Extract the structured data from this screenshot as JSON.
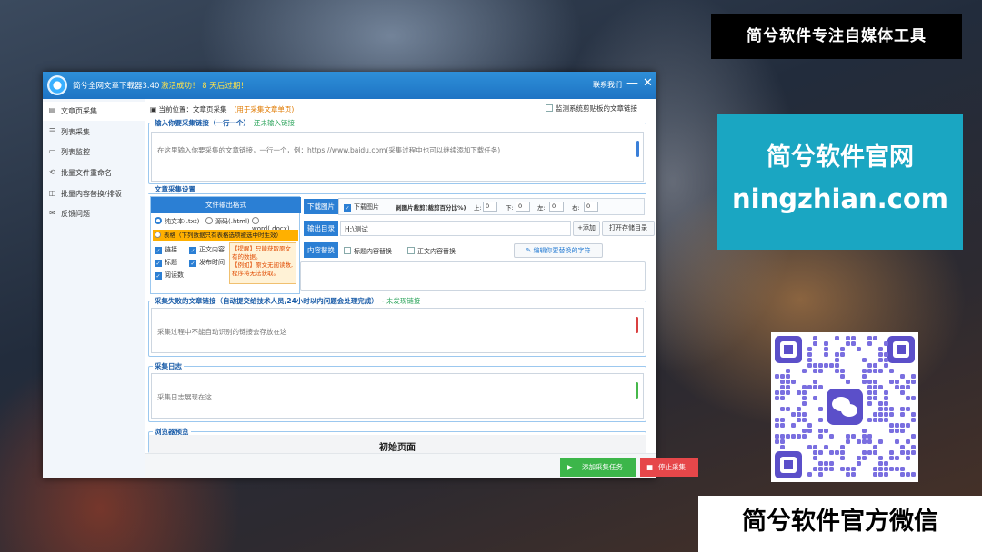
{
  "window": {
    "app_title": "简兮全网文章下载器3.40",
    "status": "激活成功！ 8 天后过期！",
    "contact": "联系我们",
    "minimize": "—",
    "close": "✕"
  },
  "sidebar": {
    "items": [
      {
        "label": "文章页采集",
        "icon": "document-icon"
      },
      {
        "label": "列表采集",
        "icon": "list-icon"
      },
      {
        "label": "列表监控",
        "icon": "monitor-icon"
      },
      {
        "label": "批量文件重命名",
        "icon": "rename-icon"
      },
      {
        "label": "批量内容替换/排版",
        "icon": "replace-icon"
      },
      {
        "label": "反馈问题",
        "icon": "feedback-icon"
      }
    ]
  },
  "breadcrumb": {
    "label": "当前位置：",
    "page": "文章页采集",
    "hint": "(用于采集文章单页)"
  },
  "monitor_clipboard": "监测系统剪贴板的文章链接",
  "input_section": {
    "title": "输入你要采集链接（一行一个）",
    "sub": "还未输入链接",
    "placeholder": "在这里输入你要采集的文章链接，一行一个，例：https://www.baidu.com(采集过程中也可以继续添加下载任务)"
  },
  "settings": {
    "title": "文章采集设置",
    "format": {
      "header": "文件输出格式",
      "options": [
        "纯文本(.txt)",
        "源码(.html)",
        "word(.docx)"
      ],
      "table_option": "表格（下列数据只有表格选项被选中时生效）",
      "fields": [
        "链接",
        "正文内容",
        "标题",
        "发布时间",
        "阅读数"
      ],
      "warn1": "【提醒】只能获取原文有的数据。",
      "warn2": "【例如】原文无阅读数,程序将无法获取。"
    },
    "download": {
      "label": "下载图片",
      "check": "下载图片",
      "crop": "剥图片裁剪(裁剪百分比%)",
      "top": "上:",
      "bottom": "下:",
      "left": "左:",
      "right": "右:",
      "top_v": "0",
      "bottom_v": "0",
      "left_v": "0",
      "right_v": "0"
    },
    "output": {
      "label": "输出目录",
      "path": "H:\\测试",
      "add": "+添加",
      "open": "打开存储目录"
    },
    "replace": {
      "label": "内容替换",
      "title_opt": "标题内容替换",
      "body_opt": "正文内容替换",
      "edit": "编辑你要替换的字符"
    }
  },
  "failed": {
    "title": "采集失败的文章链接（自动提交给技术人员,24小时以内问题会处理完成）",
    "sub": "- 未发现链接",
    "placeholder": "采集过程中不能自动识别的链接会存放在这"
  },
  "log": {
    "title": "采集日志",
    "placeholder": "采集日志展现在这......"
  },
  "browser": {
    "title": "浏览器预览",
    "page_title": "初始页面"
  },
  "buttons": {
    "add_task": "添加采集任务",
    "stop": "停止采集"
  },
  "promo": {
    "top": "简兮软件专注自媒体工具",
    "site_cn": "简兮软件官网",
    "site_url": "ningzhian.com",
    "bottom": "简兮软件官方微信"
  },
  "colors": {
    "accent": "#2b7fd4",
    "green": "#3cb64a",
    "red": "#e6474a",
    "promo_teal": "#1aa6c2"
  }
}
